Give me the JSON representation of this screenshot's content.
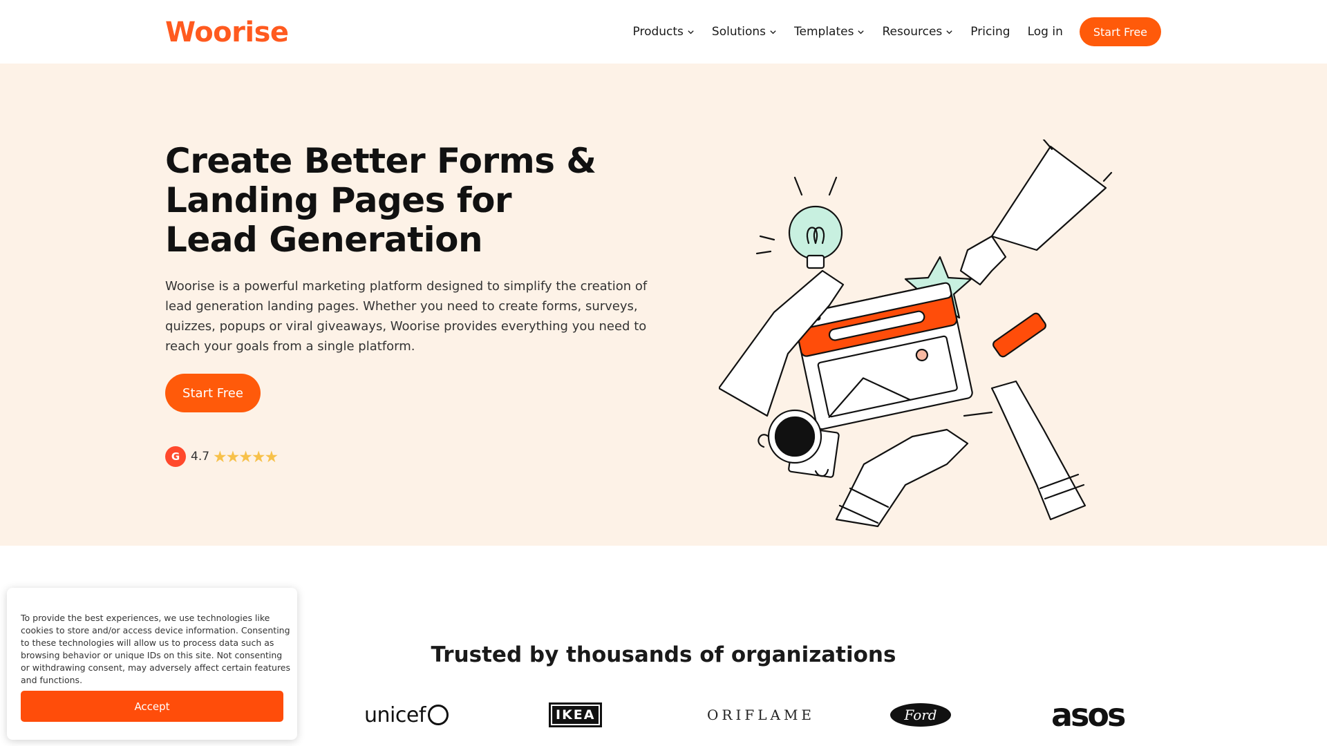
{
  "header": {
    "logo": "Woorise",
    "nav": [
      {
        "label": "Products",
        "dropdown": true
      },
      {
        "label": "Solutions",
        "dropdown": true
      },
      {
        "label": "Templates",
        "dropdown": true
      },
      {
        "label": "Resources",
        "dropdown": true
      },
      {
        "label": "Pricing",
        "dropdown": false
      },
      {
        "label": "Log in",
        "dropdown": false
      }
    ],
    "cta": "Start Free"
  },
  "hero": {
    "title": "Create Better Forms & Landing Pages for Lead Generation",
    "description": "Woorise is a powerful marketing platform designed to simplify the creation of lead generation landing pages. Whether you need to create forms, surveys, quizzes, popups or viral giveaways, Woorise provides everything you need to reach your goals from a single platform.",
    "cta": "Start Free",
    "rating": {
      "badge": "G",
      "value": "4.7",
      "stars": "★★★★★"
    }
  },
  "trusted": {
    "title": "Trusted by thousands of organizations",
    "logos": [
      "unicef",
      "IKEA",
      "ORIFLAME",
      "Ford",
      "asos"
    ]
  },
  "cookie": {
    "text": "To provide the best experiences, we use technologies like cookies to store and/or access device information. Consenting to these technologies will allow us to process data such as browsing behavior or unique IDs on this site. Not consenting or withdrawing consent, may adversely affect certain features and functions.",
    "accept": "Accept"
  },
  "colors": {
    "brand": "#ff5a0a",
    "hero_bg": "#fdf2e7",
    "star": "#f7c14a",
    "mint": "#c8f0e0"
  }
}
